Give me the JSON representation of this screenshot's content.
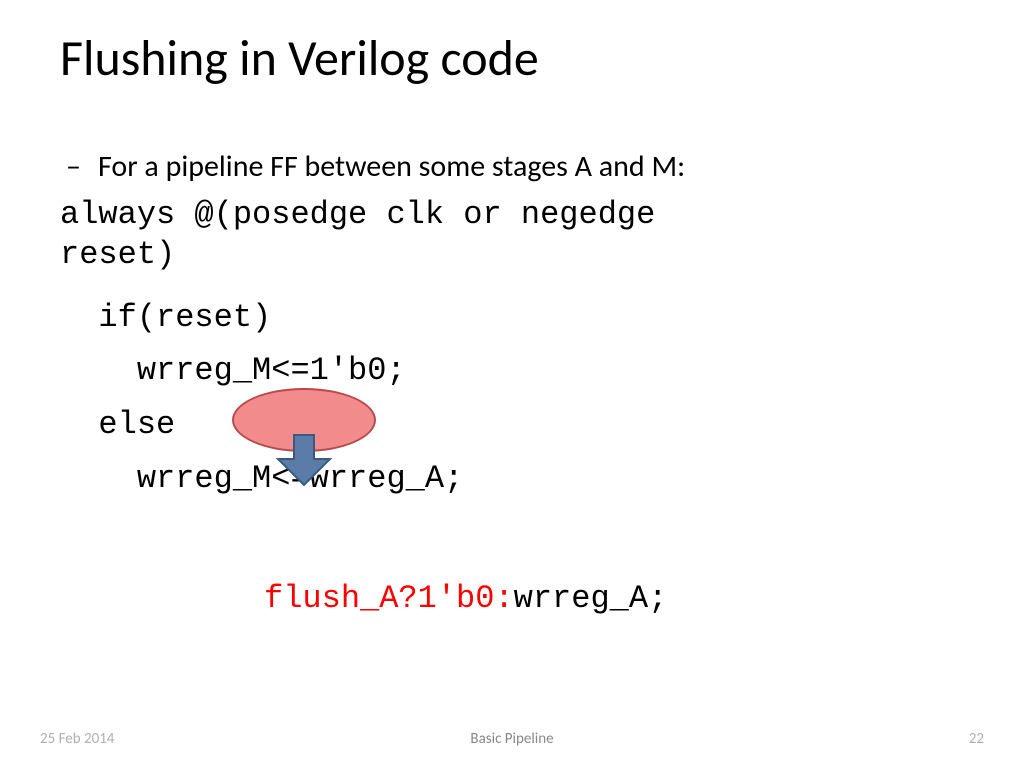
{
  "title": "Flushing in Verilog code",
  "bullet": "For a pipeline FF between some stages A and M:",
  "code": {
    "line1": "always @(posedge clk or negedge",
    "line2": "reset)",
    "line3": "  if(reset)",
    "line4": "    wrreg_M<=1'b0;",
    "line5": "  else",
    "line6": "    wrreg_M<=wrreg_A;"
  },
  "flush_red_a": "flush_A?1'b0:",
  "flush_blk": "wrreg_A;",
  "footer": {
    "date": "25 Feb 2014",
    "title": "Basic Pipeline",
    "page": "22"
  }
}
